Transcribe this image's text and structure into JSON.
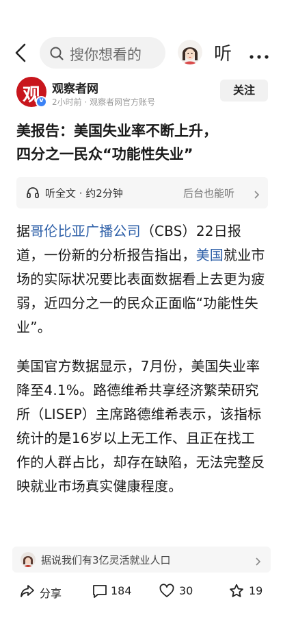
{
  "nav": {
    "search_placeholder": "搜你想看的",
    "listen_label": "听",
    "icons": [
      "back-arrow-icon",
      "search-icon",
      "avatar",
      "more-icon"
    ]
  },
  "publisher": {
    "logo_text": "观",
    "name": "观察者网",
    "meta": "2小时前 · 观察者网官方账号",
    "follow_label": "关注",
    "brand_color": "#c8161d",
    "verified_color": "#3b82f6"
  },
  "article": {
    "title_line1": "美报告：美国失业率不断上升，",
    "title_line2": "四分之一民众“功能性失业”",
    "listen_bar": {
      "left_text": "听全文 · 约2分钟",
      "right_text": "后台也能听"
    },
    "p1": {
      "t1": "据",
      "link1": "哥伦比亚广播公司",
      "t2": "（CBS）22日报道，一份新的分析报告指出，",
      "link2": "美国",
      "t3": "就业市场的实际状况要比表面数据看上去更为疲弱，近四分之一的民众正面临“功能性失业”。"
    },
    "p2": "美国官方数据显示，7月份，美国失业率降至4.1%。路德维希共享经济繁荣研究所（LISEP）主席路德维希表示，该指标统计的是16岁以上无工作、且正在找工作的人群占比，却存在缺陷，无法完整反映就业市场真实健康程度。",
    "link_color": "#2d5fa8"
  },
  "related": {
    "text": "据说我们有3亿灵活就业人口"
  },
  "actions": {
    "share_label": "分享",
    "comments_count": "184",
    "likes_count": "30",
    "favorites_count": "19"
  }
}
